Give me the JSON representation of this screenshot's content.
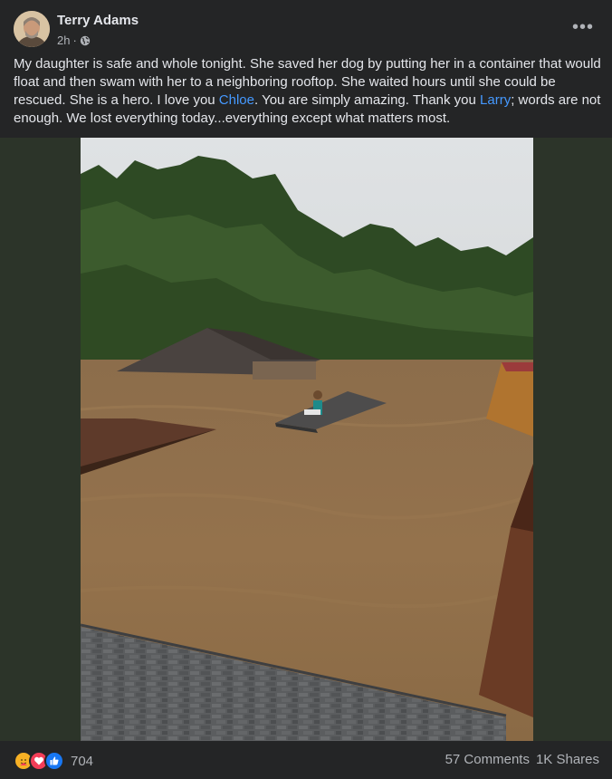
{
  "post": {
    "author": "Terry Adams",
    "time": "2h",
    "separator": "·",
    "more_label": "•••",
    "text_parts": {
      "p1": "My daughter is safe and whole tonight. She saved her dog by putting her in a container that would float and then swam with her to a neighboring rooftop. She waited hours until she could be rescued. She is a hero. I love you ",
      "mention1": "Chloe",
      "p2": ". You are simply amazing. Thank you ",
      "mention2": "Larry",
      "p3": "; words are not enough. We lost everything today...everything except what matters most."
    },
    "reactions": {
      "icons": [
        "care-icon",
        "love-icon",
        "like-icon"
      ],
      "count": "704"
    },
    "comments": "57 Comments",
    "shares": "1K Shares"
  },
  "colors": {
    "background": "#242526",
    "mention": "#4599ff",
    "water": "#8a6a45",
    "photo_side_bg": "#2c3429"
  }
}
